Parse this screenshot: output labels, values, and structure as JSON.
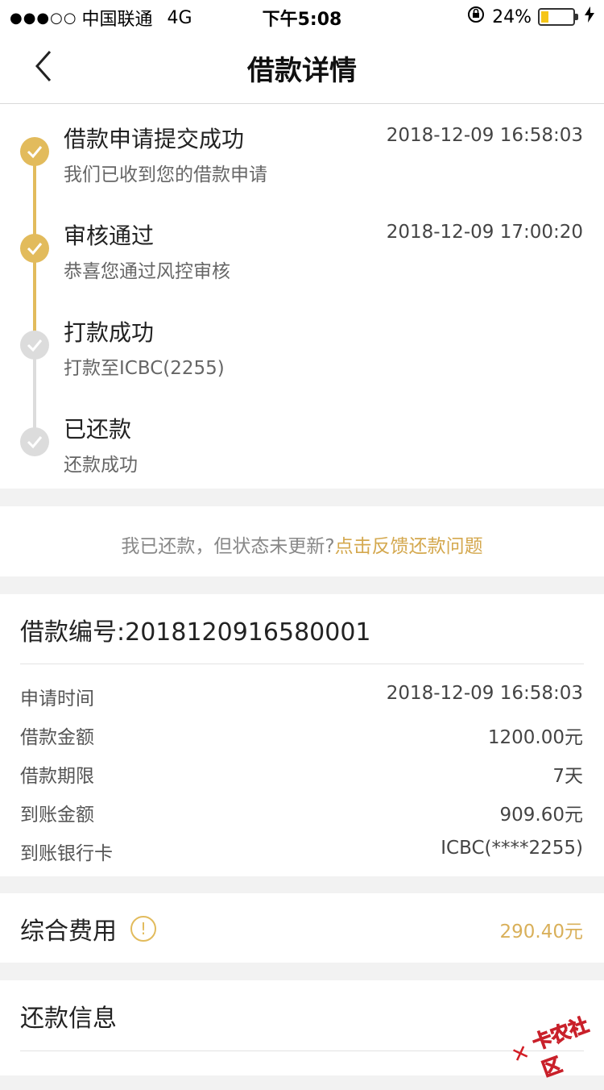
{
  "status_bar": {
    "signal": "●●●○○",
    "carrier": "中国联通",
    "network": "4G",
    "time": "下午5:08",
    "battery_percent": "24%",
    "battery_level": 0.24,
    "battery_color": "#f5c518"
  },
  "nav": {
    "title": "借款详情",
    "back_icon": "chevron-left-icon"
  },
  "timeline": {
    "active_color": "#e2bb5c",
    "inactive_color": "#dcdcdc",
    "steps": [
      {
        "title": "借款申请提交成功",
        "subtitle": "我们已收到您的借款申请",
        "time": "2018-12-09 16:58:03",
        "done": true
      },
      {
        "title": "审核通过",
        "subtitle": "恭喜您通过风控审核",
        "time": "2018-12-09 17:00:20",
        "done": true
      },
      {
        "title": "打款成功",
        "subtitle": "打款至ICBC(2255)",
        "time": "",
        "done": false
      },
      {
        "title": "已还款",
        "subtitle": "还款成功",
        "time": "",
        "done": false
      }
    ]
  },
  "feedback": {
    "text": "我已还款，但状态未更新?",
    "link": "点击反馈还款问题"
  },
  "loan": {
    "title": "借款编号:2018120916580001",
    "rows": [
      {
        "label": "申请时间",
        "value": "2018-12-09 16:58:03"
      },
      {
        "label": "借款金额",
        "value": "1200.00元"
      },
      {
        "label": "借款期限",
        "value": "7天"
      },
      {
        "label": "到账金额",
        "value": "909.60元"
      },
      {
        "label": "到账银行卡",
        "value": "ICBC(****2255)"
      }
    ]
  },
  "fee": {
    "title": "综合费用",
    "icon": "info-icon",
    "value": "290.40元"
  },
  "repay": {
    "title": "还款信息"
  },
  "watermark": {
    "text": "卡农社区"
  }
}
